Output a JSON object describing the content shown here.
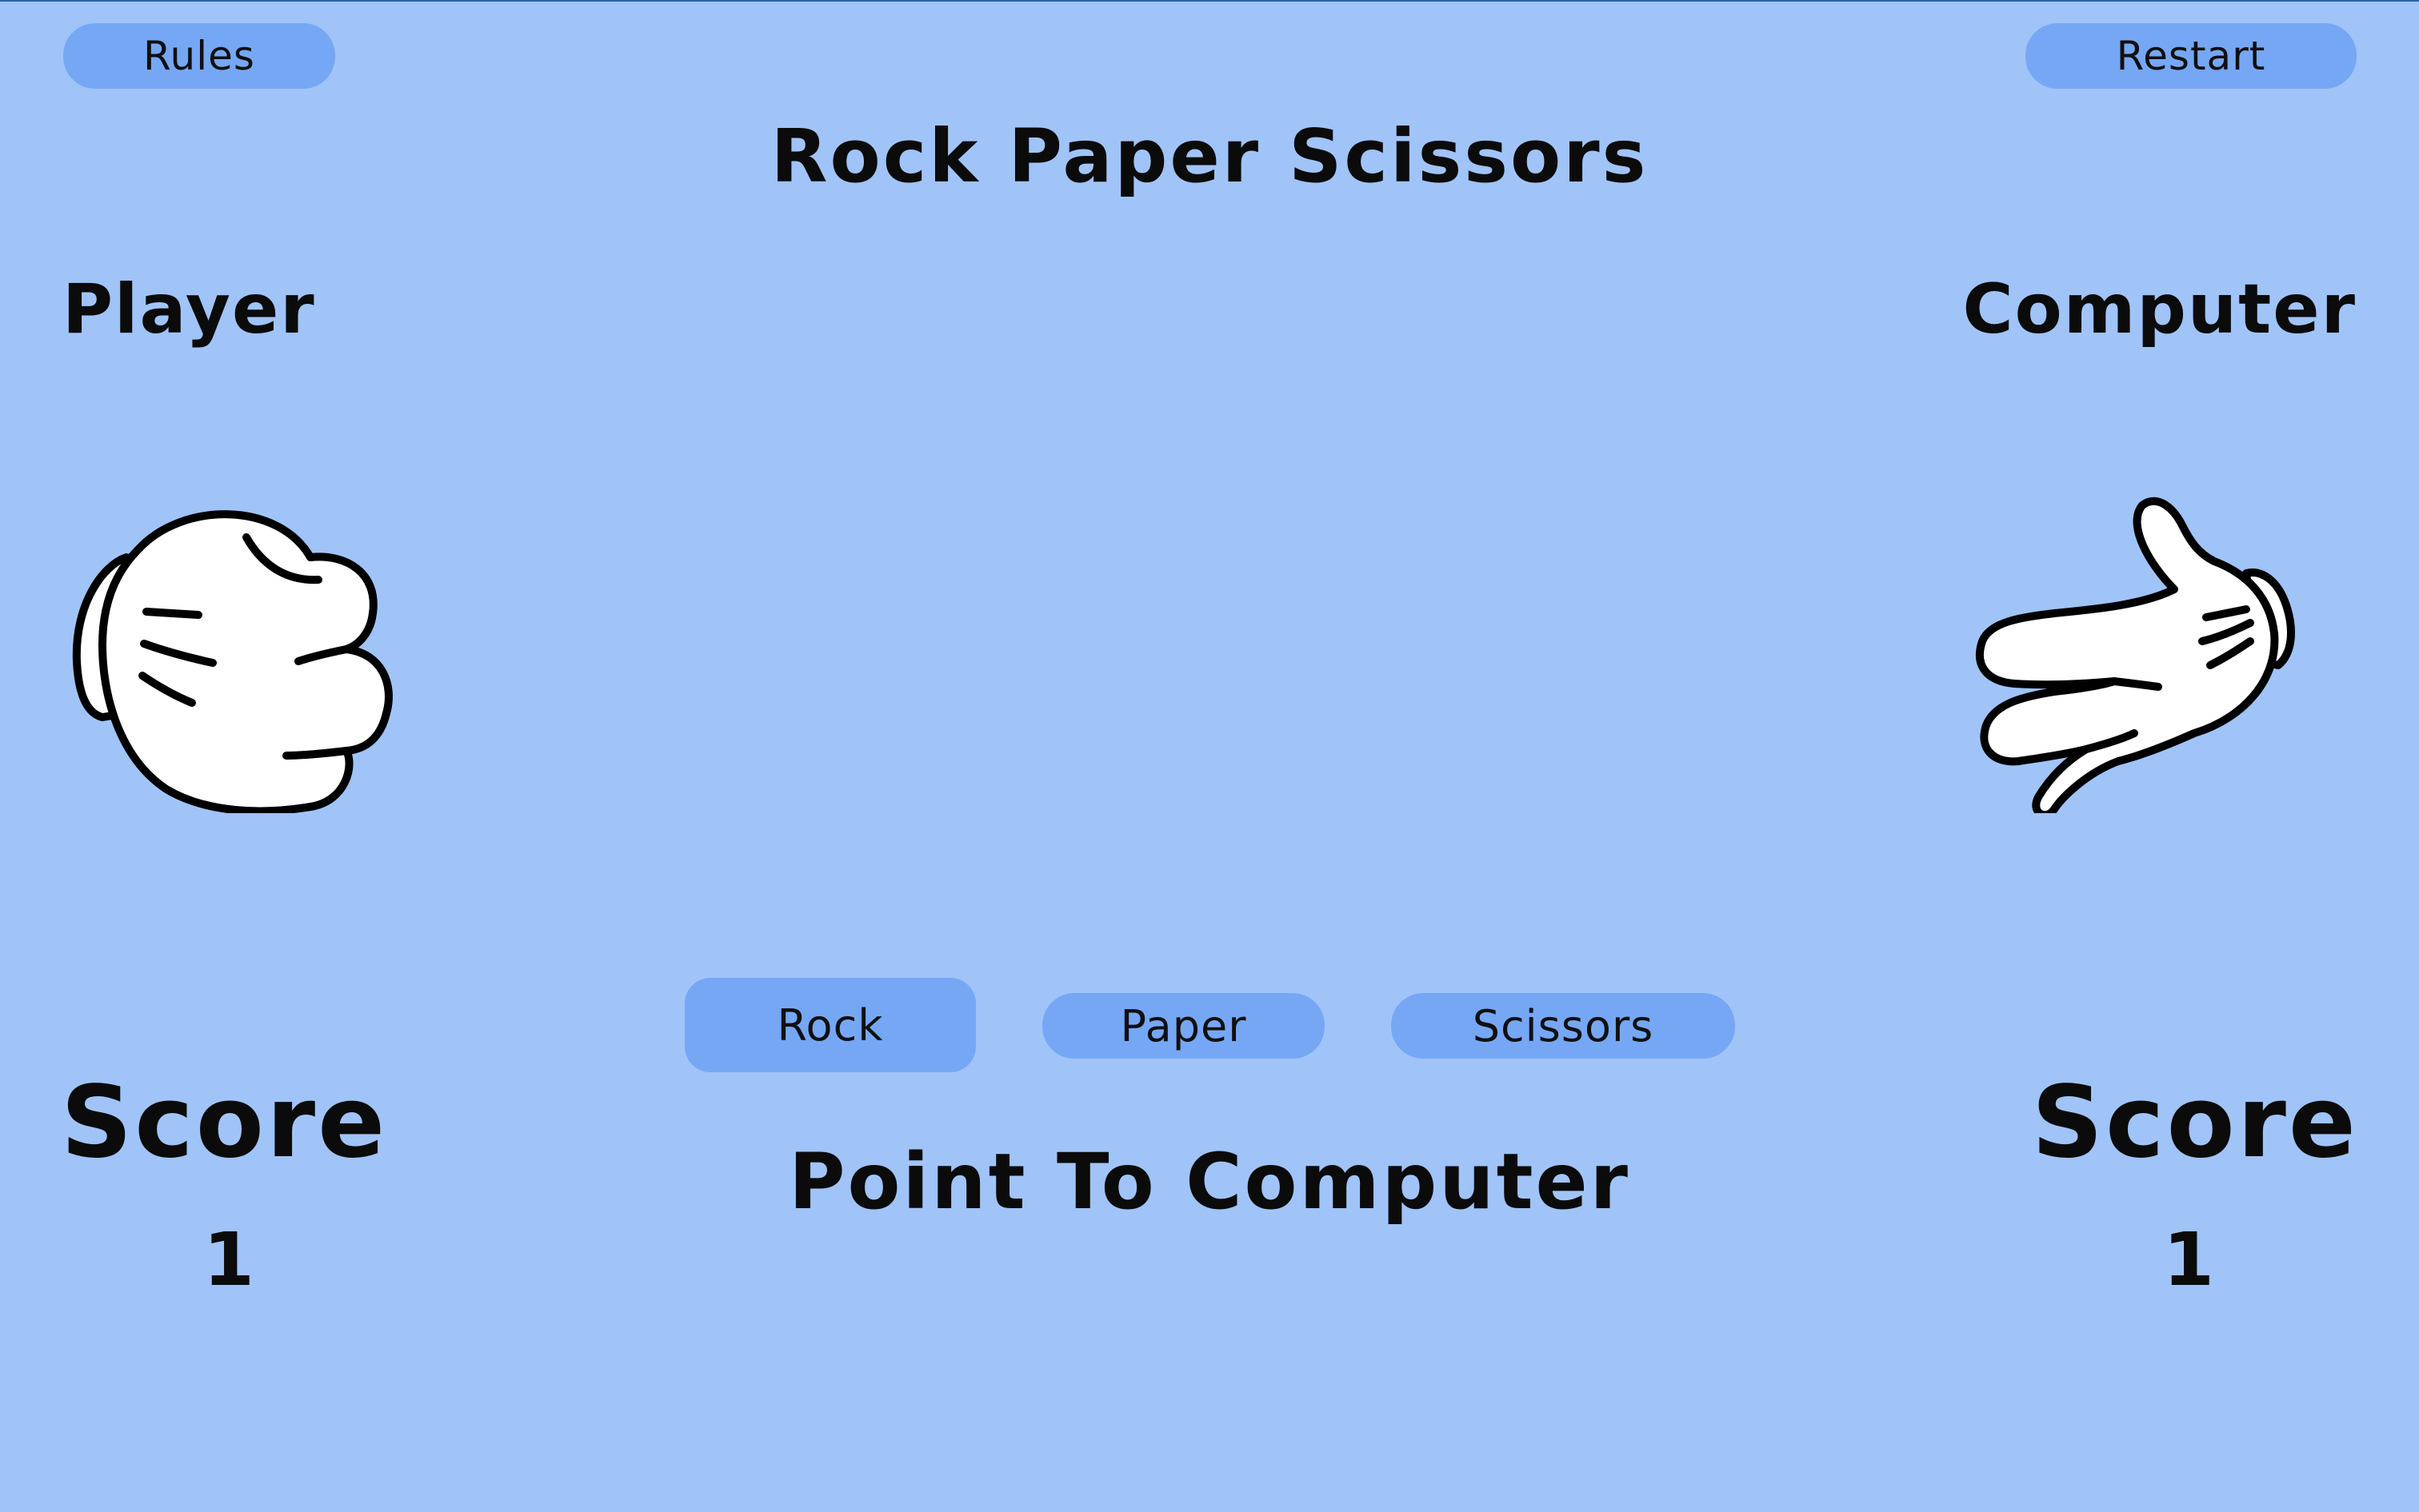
{
  "header": {
    "rules_label": "Rules",
    "restart_label": "Restart",
    "title": "Rock Paper Scissors"
  },
  "player": {
    "label": "Player",
    "hand": "rock-hand-icon",
    "score_label": "Score",
    "score": "1"
  },
  "computer": {
    "label": "Computer",
    "hand": "scissors-hand-icon",
    "score_label": "Score",
    "score": "1"
  },
  "choices": {
    "rock": "Rock",
    "paper": "Paper",
    "scissors": "Scissors"
  },
  "result": "Point To Computer",
  "colors": {
    "background": "#a0c4f8",
    "button": "#76a7f5",
    "text": "#0b0b0b"
  }
}
